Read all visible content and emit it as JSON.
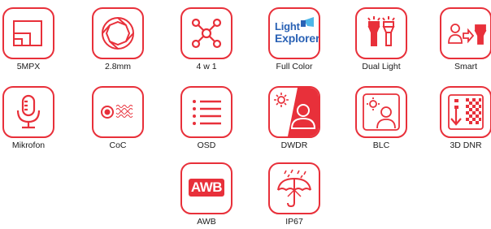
{
  "accent_color": "#e8303a",
  "features": [
    {
      "label": "5MPX",
      "icon": "resolution-icon"
    },
    {
      "label": "2.8mm",
      "icon": "lens-aperture-icon"
    },
    {
      "label": "4 w 1",
      "icon": "hub-network-icon"
    },
    {
      "label": "Full Color",
      "icon": "light-explorer-logo",
      "logo_text_1": "Light",
      "logo_text_2": "Explorer"
    },
    {
      "label": "Dual Light",
      "icon": "dual-light-icon"
    },
    {
      "label": "Smart",
      "icon": "smart-dual-light-icon"
    },
    {
      "label": "Mikrofon",
      "icon": "microphone-icon"
    },
    {
      "label": "CoC",
      "icon": "coc-icon"
    },
    {
      "label": "OSD",
      "icon": "osd-list-icon"
    },
    {
      "label": "DWDR",
      "icon": "dwdr-icon"
    },
    {
      "label": "BLC",
      "icon": "blc-icon"
    },
    {
      "label": "3D DNR",
      "icon": "3d-dnr-icon"
    },
    {
      "label": "AWB",
      "icon": "awb-icon",
      "badge_text": "AWB"
    },
    {
      "label": "IP67",
      "icon": "ip67-umbrella-icon"
    }
  ]
}
